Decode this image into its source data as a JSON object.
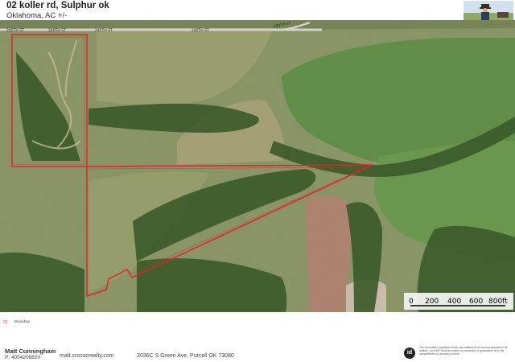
{
  "header": {
    "title": "02 koller rd, Sulphur ok",
    "subtitle": "Oklahoma,  AC +/-"
  },
  "map": {
    "road_labels": [
      "240TH ST",
      "240TH ST",
      "240TH ST",
      "240TH ST",
      "240TH ST"
    ],
    "scale": {
      "ticks": [
        "0",
        "200",
        "400",
        "600",
        "800ft"
      ]
    },
    "boundary_color": "#e0242c"
  },
  "legend": {
    "label": "Boundary",
    "icon": "boundary-icon"
  },
  "footer": {
    "agent_name": "Matt Cunningham",
    "phone": "P: 4054208820",
    "website": "matt.crosscrealty.com",
    "address": "2036C S Green Ave, Purcell OK 73080",
    "logo": "id",
    "disclaimer": "The information contained herein was obtained from sources deemed to be reliable. Land id® Services makes no warranties or guarantees as to the completeness or accuracy thereof."
  }
}
